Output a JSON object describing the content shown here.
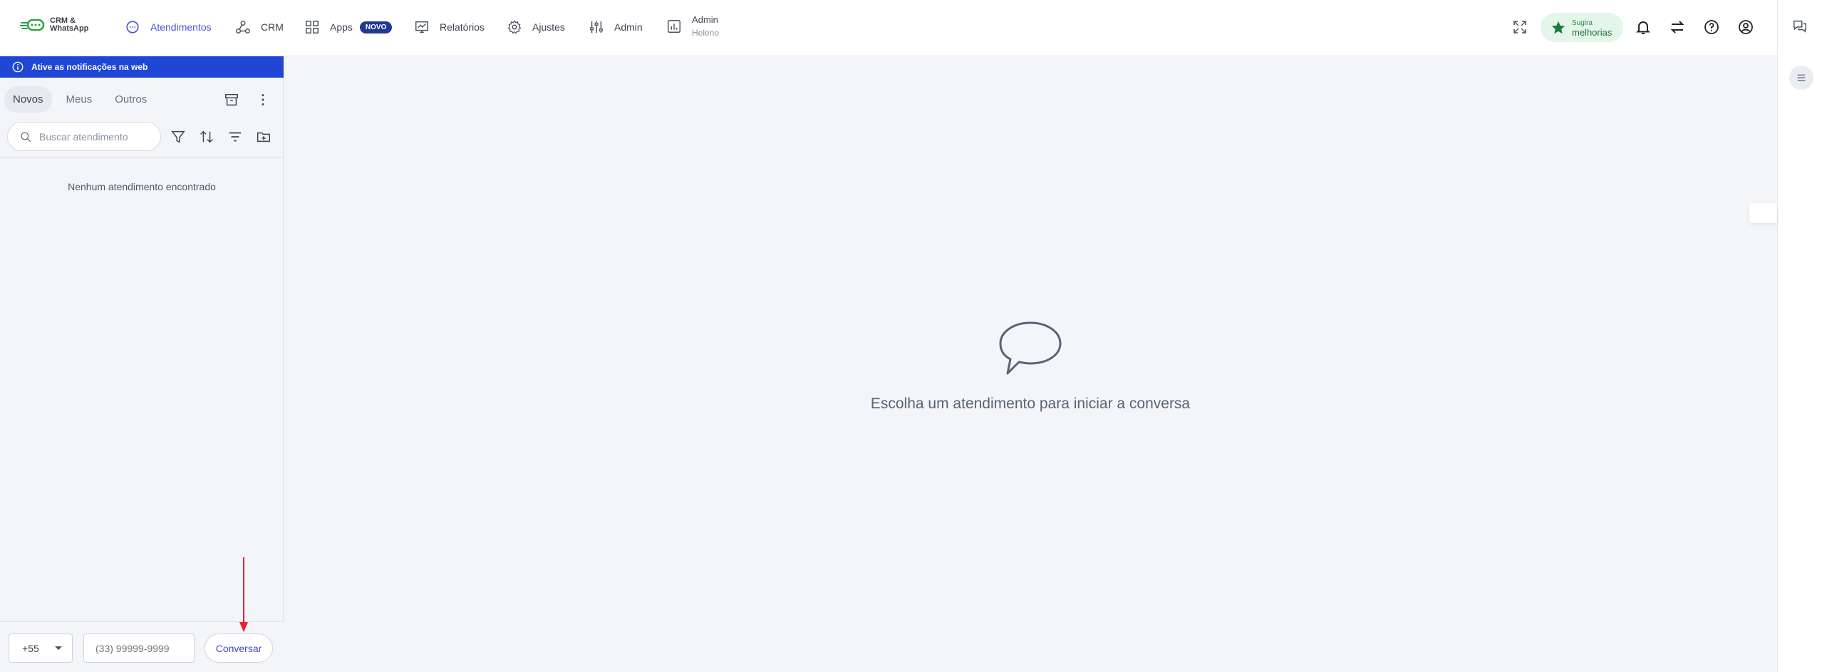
{
  "app": {
    "logo_line1": "CRM &",
    "logo_line2": "WhatsApp"
  },
  "nav": {
    "items": [
      {
        "label": "Atendimentos",
        "icon": "chat-bubble-icon",
        "active": true
      },
      {
        "label": "CRM",
        "icon": "crm-nodes-icon"
      },
      {
        "label": "Apps",
        "icon": "apps-grid-icon",
        "badge": "NOVO"
      },
      {
        "label": "Relatórios",
        "icon": "report-chart-icon"
      },
      {
        "label": "Ajustes",
        "icon": "gear-icon"
      },
      {
        "label": "Admin",
        "icon": "sliders-icon"
      }
    ],
    "user": {
      "name": "Admin",
      "sub": "Heleno",
      "icon": "bar-chart-icon"
    }
  },
  "topright": {
    "suggest_line1": "Sugira",
    "suggest_line2": "melhorias",
    "icons": [
      "fullscreen-icon",
      "star-icon",
      "bell-icon",
      "swap-arrows-icon",
      "help-icon",
      "user-circle-icon"
    ]
  },
  "notification_banner": "Ative as notificações na web",
  "tabs": [
    "Novos",
    "Meus",
    "Outros"
  ],
  "search": {
    "placeholder": "Buscar atendimento"
  },
  "empty_list": "Nenhum atendimento encontrado",
  "bottom": {
    "country_code": "+55",
    "phone_placeholder": "(33) 99999-9999",
    "button": "Conversar"
  },
  "main": {
    "message": "Escolha um atendimento para iniciar a conversa"
  },
  "colors": {
    "accent": "#4a55d8",
    "banner": "#2046d6",
    "badge": "#1f3a93",
    "annotation_arrow": "#e5222e"
  }
}
